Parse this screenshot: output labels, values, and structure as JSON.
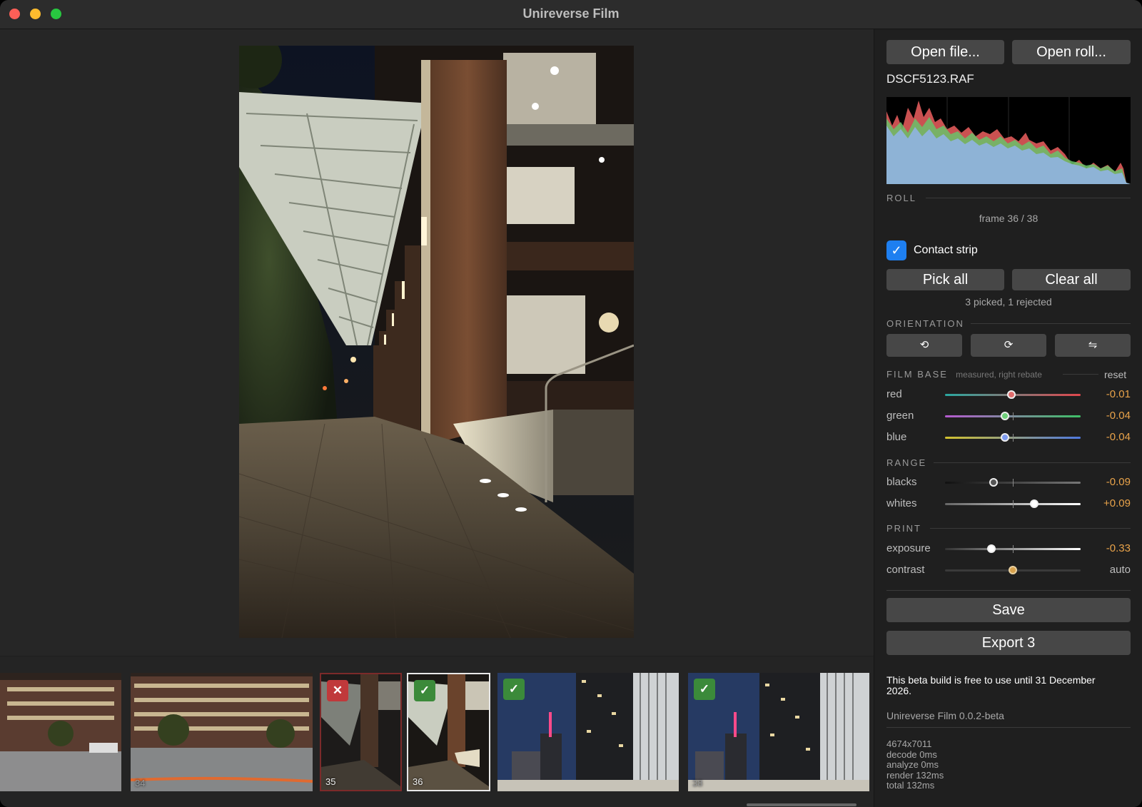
{
  "window": {
    "title": "Unireverse Film"
  },
  "toolbar": {
    "open_file": "Open file...",
    "open_roll": "Open roll..."
  },
  "file": {
    "name": "DSCF5123.RAF"
  },
  "roll": {
    "heading": "ROLL",
    "frame_text": "frame 36 / 38",
    "contact_strip_label": "Contact strip",
    "contact_strip_checked": true,
    "pick_all": "Pick all",
    "clear_all": "Clear all",
    "pick_summary": "3 picked, 1 rejected"
  },
  "orientation": {
    "heading": "ORIENTATION",
    "rotate_left_icon": "⟲",
    "rotate_right_icon": "⟳",
    "flip_icon": "⇋"
  },
  "film_base": {
    "heading": "FILM BASE",
    "note": "measured, right rebate",
    "reset": "reset",
    "red": {
      "label": "red",
      "value": "-0.01",
      "knob_color": "#e06d6d"
    },
    "green": {
      "label": "green",
      "value": "-0.04",
      "knob_color": "#6fd07a"
    },
    "blue": {
      "label": "blue",
      "value": "-0.04",
      "knob_color": "#7f9cf0"
    }
  },
  "range": {
    "heading": "RANGE",
    "blacks": {
      "label": "blacks",
      "value": "-0.09"
    },
    "whites": {
      "label": "whites",
      "value": "+0.09"
    }
  },
  "print": {
    "heading": "PRINT",
    "exposure": {
      "label": "exposure",
      "value": "-0.33"
    },
    "contrast": {
      "label": "contrast",
      "value": "auto"
    }
  },
  "actions": {
    "save": "Save",
    "export": "Export 3"
  },
  "footer": {
    "beta_notice": "This beta build is free to use until 31 December 2026.",
    "version": "Unireverse Film 0.0.2-beta",
    "stats": [
      "4674x7011",
      "decode 0ms",
      "analyze 0ms",
      "render 132ms",
      "total 132ms"
    ]
  },
  "filmstrip": {
    "frames": [
      {
        "number": "",
        "status": "none"
      },
      {
        "number": "34",
        "status": "none"
      },
      {
        "number": "35",
        "status": "rejected",
        "badge": "✕"
      },
      {
        "number": "36",
        "status": "picked",
        "badge": "✓",
        "selected": true
      },
      {
        "number": "",
        "status": "picked",
        "badge": "✓"
      },
      {
        "number": "38",
        "status": "picked",
        "badge": "✓"
      }
    ]
  },
  "colors": {
    "accent": "#1e7ff0",
    "value_orange": "#e9a34a",
    "picked": "#3b8a3a",
    "rejected": "#c0393b"
  }
}
